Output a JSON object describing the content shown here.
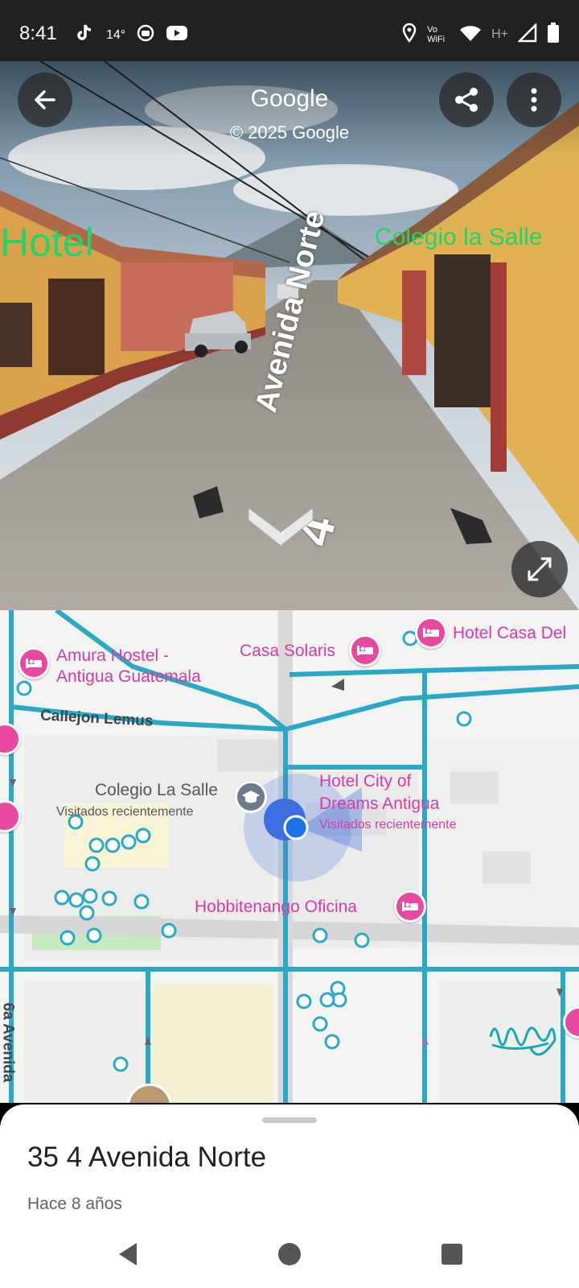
{
  "status_bar": {
    "time": "8:41",
    "temperature": "14°",
    "network": "H+",
    "icons": [
      "tiktok-icon",
      "camera-icon",
      "youtube-icon",
      "location-icon",
      "vowifi-icon",
      "wifi-icon",
      "signal-icon",
      "battery-icon"
    ],
    "vowifi_label": "Vo WiFi"
  },
  "street_view": {
    "title": "Google",
    "copyright": "© 2025 Google",
    "labels": {
      "hotel": "Hotel",
      "colegio": "Colegio la Salle",
      "street_number": "4",
      "street_name": "Avenida Norte"
    }
  },
  "map": {
    "pois": {
      "amura": "Amura Hostel -\nAntigua Guatemala",
      "casa_solaris": "Casa Solaris",
      "hotel_casa": "Hotel Casa Del",
      "hotel_city_line1": "Hotel City of",
      "hotel_city_line2": "Dreams Antigua",
      "hotel_city_sub": "Visitados recientemente",
      "colegio": "Colegio La Salle",
      "colegio_sub": "Visitados recientemente",
      "hobbitenango": "Hobbitenango Oficina"
    },
    "streets": {
      "callejon": "Callejon Lemus",
      "sexta_avenida": "6a Avenida"
    },
    "colors": {
      "road": "#2aa9c6",
      "poi": "#d63aa9",
      "location": "#1a73e8"
    }
  },
  "sheet": {
    "title": "35 4 Avenida Norte",
    "subtitle": "Hace 8 años"
  }
}
